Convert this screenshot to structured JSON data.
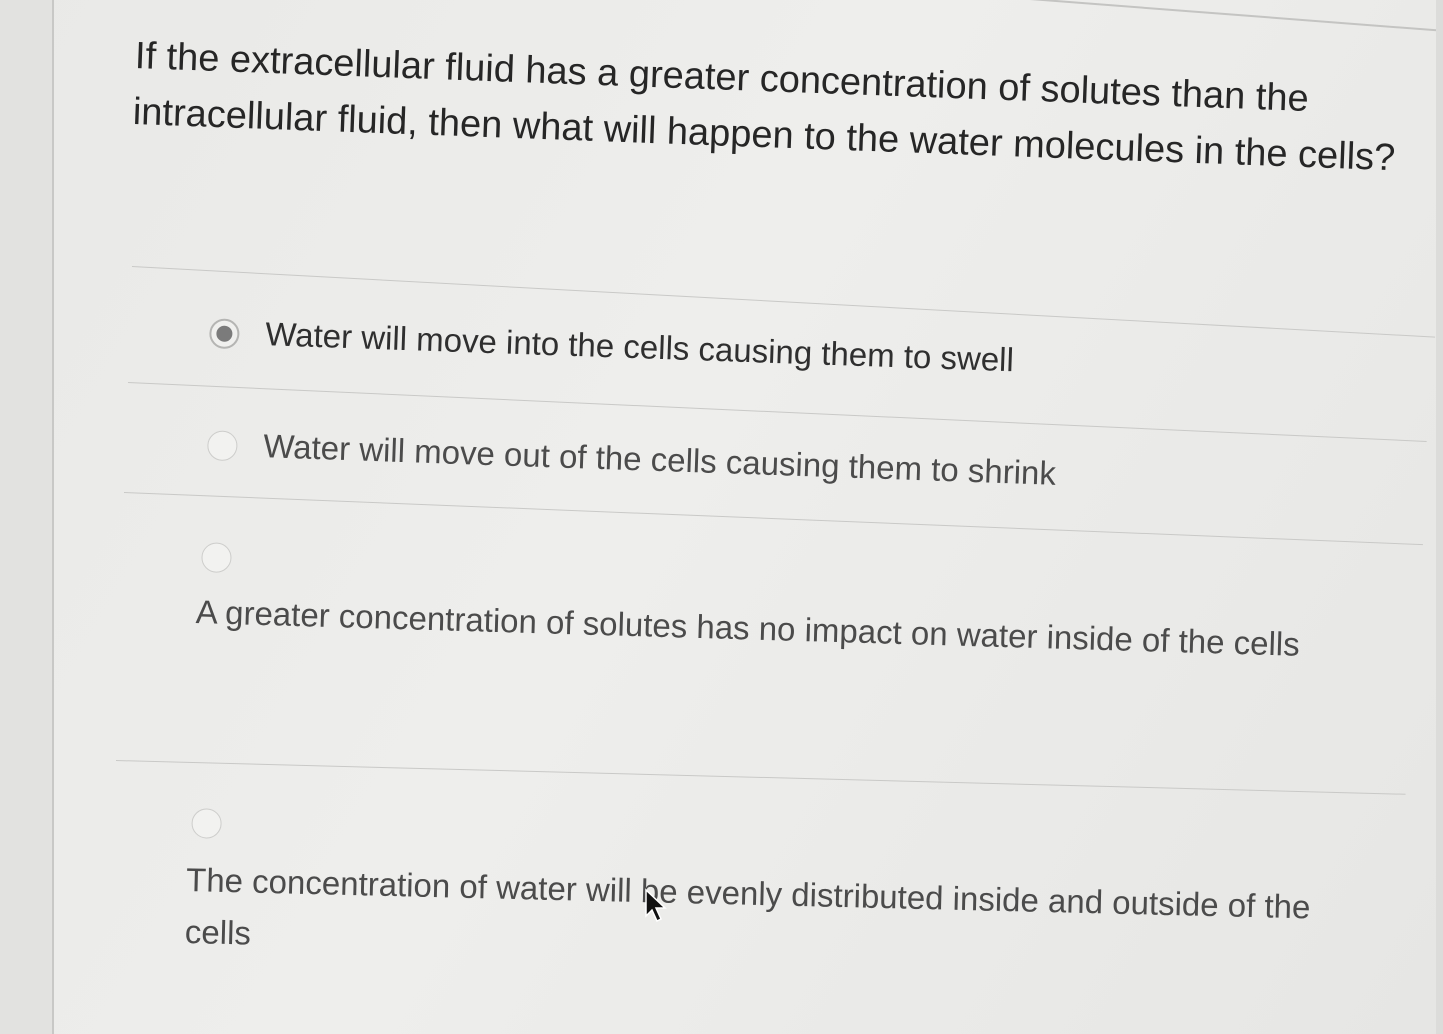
{
  "question": {
    "text": "If the extracellular fluid has a greater concentration of solutes than the intracellular fluid, then what will happen to the water molecules in the cells?"
  },
  "options": [
    {
      "label": "Water will move into the cells causing them to swell",
      "selected": true
    },
    {
      "label": "Water will move out of the cells causing them to shrink",
      "selected": false
    },
    {
      "label": "A greater concentration of solutes has no impact on water inside of the cells",
      "selected": false
    },
    {
      "label": "The concentration of water will be evenly distributed inside and outside of the cells",
      "selected": false
    }
  ],
  "colors": {
    "text": "#262626",
    "divider": "#c9c9c7",
    "radio_selected_dot": "#7b7b7b",
    "background": "#eeeeec"
  },
  "icons": {
    "cursor": "mouse-pointer-icon",
    "radio": "radio-button-icon"
  }
}
